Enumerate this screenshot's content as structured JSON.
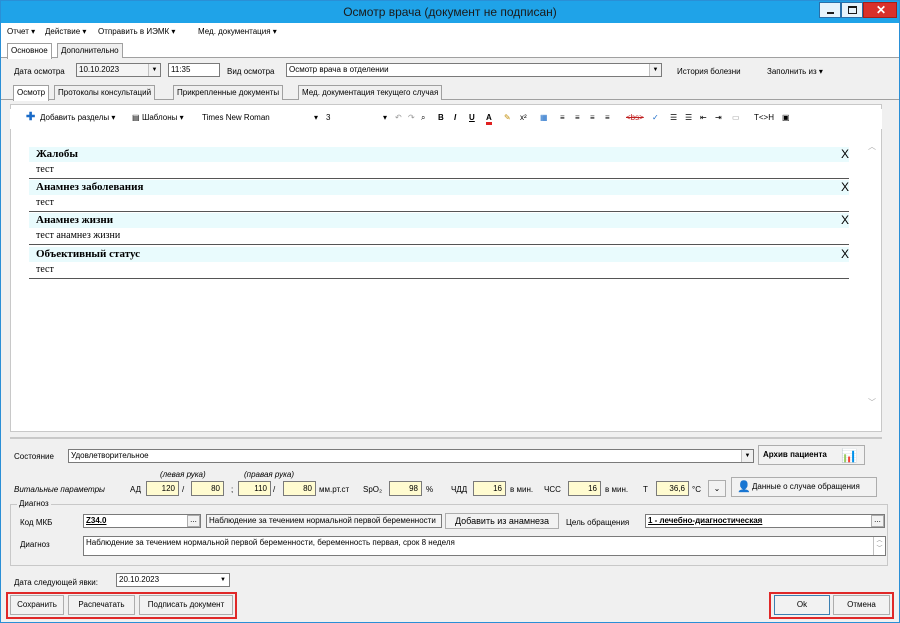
{
  "window": {
    "title": "Осмотр врача (документ не подписан)"
  },
  "menu": [
    "Отчет ▾",
    "Действие ▾",
    "Отправить в ИЭМК ▾",
    "Мед. документация ▾"
  ],
  "tabs_main": [
    "Основное",
    "Дополнительно"
  ],
  "header": {
    "date_label": "Дата осмотра",
    "date_value": "10.10.2023",
    "time_value": "11:35",
    "type_label": "Вид осмотра",
    "type_value": "Осмотр врача в отделении",
    "history_link": "История болезни",
    "fill_label": "Заполнить из ▾"
  },
  "tabs_sub": [
    "Осмотр",
    "Протоколы консультаций",
    "Прикрепленные документы",
    "Мед. документация текущего случая"
  ],
  "toolbar": {
    "add_sections": "Добавить разделы ▾",
    "templates": "Шаблоны ▾",
    "font": "Times New Roman",
    "size": "3",
    "strike": "<bs>",
    "tch": "T<>H"
  },
  "sections": [
    {
      "title": "Жалобы",
      "text": "тест",
      "remove": "X"
    },
    {
      "title": "Анамнез заболевания",
      "text": "тест",
      "remove": "X"
    },
    {
      "title": "Анамнез жизни",
      "text": "тест анамнез жизни",
      "remove": "X"
    },
    {
      "title": "Объективный статус",
      "text": "тест",
      "remove": "X"
    }
  ],
  "state": {
    "label": "Состояние",
    "value": "Удовлетворительное",
    "archive_button": "Архив пациента"
  },
  "vitals": {
    "label": "Витальные параметры",
    "ad_label": "АД",
    "left_arm": "(левая рука)",
    "right_arm": "(правая рука)",
    "left_sys": "120",
    "left_dia": "80",
    "right_sys": "110",
    "right_dia": "80",
    "sep1": "/",
    "sep2": ";",
    "sep3": "/",
    "ad_unit": "мм.рт.ст",
    "spo2_label": "SpO₂",
    "spo2": "98",
    "spo2_unit": "%",
    "chdd_label": "ЧДД",
    "chdd": "16",
    "chdd_unit": "в мин.",
    "chss_label": "ЧСС",
    "chss": "16",
    "chss_unit": "в мин.",
    "t_label": "Т",
    "t": "36,6",
    "t_unit": "°С",
    "case_button": "Данные о случае обращения"
  },
  "diagnosis": {
    "group_label": "Диагноз",
    "mkb_label": "Код МКБ",
    "mkb_code": "Z34.0",
    "mkb_name": "Наблюдение за течением нормальной первой беременности",
    "add_anamnesis": "Добавить из анамнеза",
    "purpose_label": "Цель обращения",
    "purpose_value": "1 - лечебно-диагностическая",
    "diag_label": "Диагноз",
    "diag_text": "Наблюдение за течением нормальной первой беременности, беременность первая, срок 8 неделя"
  },
  "next_visit": {
    "label": "Дата следующей явки:",
    "value": "20.10.2023"
  },
  "buttons": {
    "save": "Сохранить",
    "print": "Распечатать",
    "sign": "Подписать документ",
    "ok": "Ok",
    "cancel": "Отмена"
  },
  "colors": {
    "titlebar": "#1fa3e8",
    "highlight": "#e02828",
    "section_bg": "#e9fbfd",
    "vital_bg": "#fffbd0"
  }
}
